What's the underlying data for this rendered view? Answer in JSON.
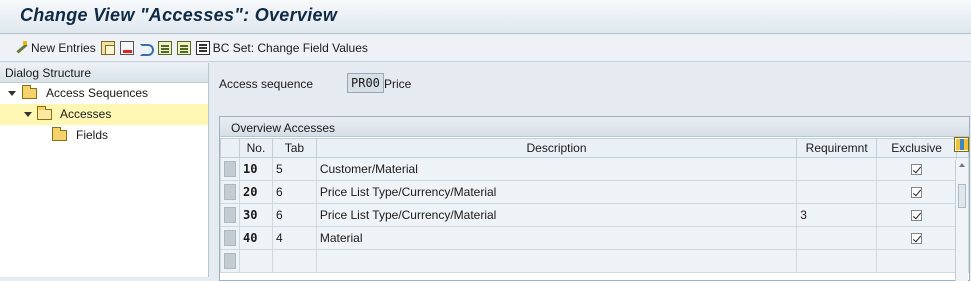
{
  "window": {
    "title": "Change View \"Accesses\": Overview"
  },
  "toolbar": {
    "new_entries_label": "New Entries",
    "bc_set_label": "BC Set: Change Field Values",
    "icons": [
      "wand-icon",
      "copy-icon",
      "delete-icon",
      "undo-icon",
      "select-all-icon",
      "deselect-all-icon",
      "bc-set-icon"
    ]
  },
  "dialog_structure": {
    "header": "Dialog Structure",
    "items": [
      {
        "label": "Access Sequences",
        "level": 0,
        "expanded": true,
        "selected": false
      },
      {
        "label": "Accesses",
        "level": 1,
        "expanded": true,
        "selected": true
      },
      {
        "label": "Fields",
        "level": 2,
        "expanded": false,
        "selected": false
      }
    ]
  },
  "access_sequence": {
    "label": "Access sequence",
    "code": "PR00",
    "description": "Price"
  },
  "overview": {
    "title": "Overview Accesses",
    "columns": [
      "No.",
      "Tab",
      "Description",
      "Requiremnt",
      "Exclusive"
    ],
    "rows": [
      {
        "no": "10",
        "tab": "5",
        "description": "Customer/Material",
        "requirement": "",
        "exclusive": true
      },
      {
        "no": "20",
        "tab": "6",
        "description": "Price List Type/Currency/Material",
        "requirement": "",
        "exclusive": true
      },
      {
        "no": "30",
        "tab": "6",
        "description": "Price List Type/Currency/Material",
        "requirement": "3",
        "exclusive": true
      },
      {
        "no": "40",
        "tab": "4",
        "description": "Material",
        "requirement": "",
        "exclusive": true
      }
    ]
  },
  "colors": {
    "selected_tree_item": "#fff7b3",
    "title_text": "#0f2a44",
    "background": "#e5ebf0"
  }
}
